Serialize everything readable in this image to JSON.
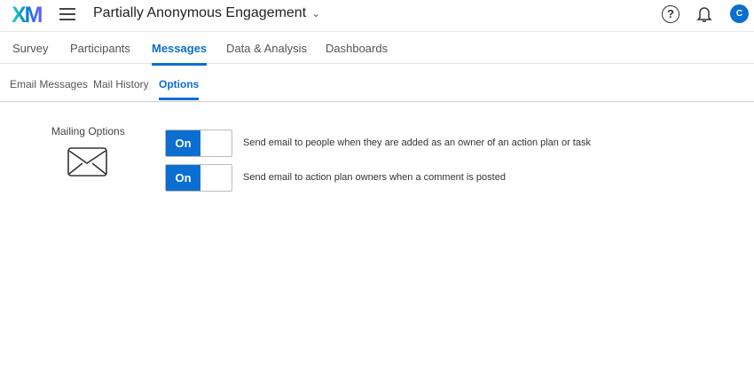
{
  "header": {
    "logo": "XM",
    "title": "Partially Anonymous Engagement",
    "help": "?",
    "avatar": "C"
  },
  "tabs": [
    "Survey",
    "Participants",
    "Messages",
    "Data & Analysis",
    "Dashboards"
  ],
  "subtabs": [
    "Email Messages",
    "Mail History",
    "Options"
  ],
  "mailing": {
    "label": "Mailing Options",
    "options": [
      {
        "state": "On",
        "text": "Send email to people when they are added as an owner of an action plan or task"
      },
      {
        "state": "On",
        "text": "Send email to action plan owners when a comment is posted"
      }
    ]
  },
  "colors": {
    "accent": "#0b6ed0"
  }
}
